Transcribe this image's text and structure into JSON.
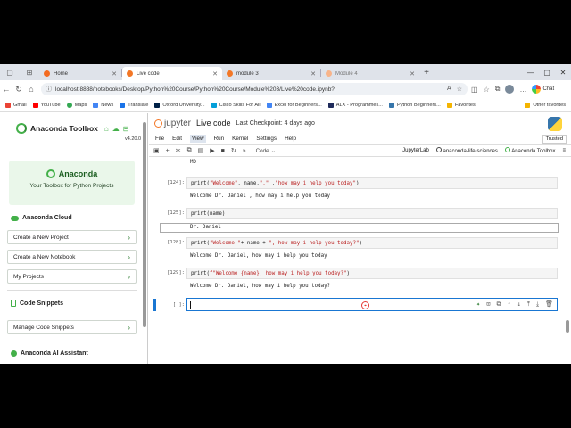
{
  "browser": {
    "tabs": [
      {
        "label": "Home",
        "color": "#f36b21",
        "active": false
      },
      {
        "label": "Live code",
        "color": "#f37726",
        "active": true
      },
      {
        "label": "module 3",
        "color": "#f37726",
        "active": false
      },
      {
        "label": "Module 4",
        "color": "#f37726",
        "active": false
      }
    ],
    "url": "localhost:8888/notebooks/Desktop/Python%20Course/Python%20Course/Module%203/Live%20code.ipynb?",
    "chat_label": "Chat",
    "bookmarks": [
      "Gmail",
      "YouTube",
      "Maps",
      "News",
      "Translate",
      "Oxford University...",
      "Cisco Skills For All",
      "Excel for Beginners...",
      "ALX - Programmes...",
      "Python Beginners...",
      "Favorites"
    ],
    "other_favorites": "Other favorites"
  },
  "sidebar": {
    "title": "Anaconda Toolbox",
    "version": "v4.20.0",
    "promo_brand": "Anaconda",
    "promo_text": "Your Toolbox for Python Projects",
    "cloud_heading": "Anaconda Cloud",
    "buttons": [
      "Create a New Project",
      "Create a New Notebook",
      "My Projects"
    ],
    "snippets_heading": "Code Snippets",
    "manage_snippets": "Manage Code Snippets",
    "ai_heading": "Anaconda AI Assistant"
  },
  "jupyter": {
    "logo_text": "jupyter",
    "notebook_name": "Live code",
    "checkpoint": "Last Checkpoint: 4 days ago",
    "menu": [
      "File",
      "Edit",
      "View",
      "Run",
      "Kernel",
      "Settings",
      "Help"
    ],
    "active_menu": "View",
    "trusted": "Trusted",
    "cell_type": "Code",
    "jupyterlab": "JupyterLab",
    "kernel": "anaconda-life-sciences",
    "toolbox": "Anaconda Toolbox"
  },
  "cells": {
    "top_output": "MD",
    "c124_prompt": "[124]:",
    "c124_code_a": "print(",
    "c124_str1": "\"Welcome\"",
    "c124_code_b": ", name,",
    "c124_str2": "\",\"",
    "c124_code_c": " ,",
    "c124_str3": "\"how may i help you today\"",
    "c124_code_d": ")",
    "c124_out": "Welcome Dr. Daniel , how may i help you today",
    "c125_prompt": "[125]:",
    "c125_code": "print(name)",
    "c125_out": "Dr. Daniel",
    "c128_prompt": "[128]:",
    "c128_code_a": "print(",
    "c128_str1": "\"Welcome \"",
    "c128_code_b": "+ name + ",
    "c128_str2": "\", how may i help you today?\"",
    "c128_code_c": ")",
    "c128_out": "Welcome Dr. Daniel, how may i help you today",
    "c129_prompt": "[129]:",
    "c129_code_a": "print(",
    "c129_str": "f\"Welcome {name}, how may i help you today?\"",
    "c129_code_b": ")",
    "c129_out": "Welcome Dr. Daniel, how may i help you today?",
    "active_prompt": "[ ]:"
  }
}
